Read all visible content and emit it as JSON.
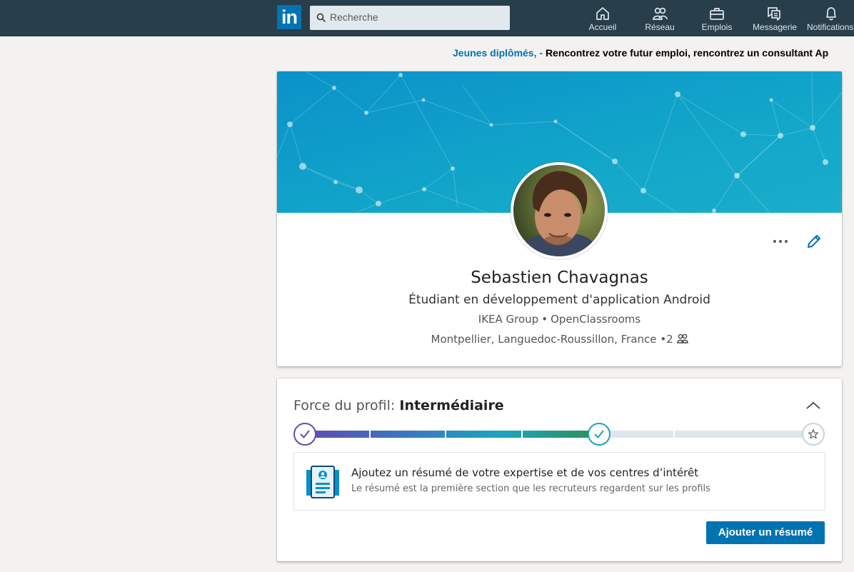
{
  "nav": {
    "search_placeholder": "Recherche",
    "items": [
      {
        "label": "Accueil",
        "icon": "home-icon"
      },
      {
        "label": "Réseau",
        "icon": "network-icon"
      },
      {
        "label": "Emplois",
        "icon": "briefcase-icon"
      },
      {
        "label": "Messagerie",
        "icon": "messaging-icon"
      },
      {
        "label": "Notifications",
        "icon": "bell-icon"
      }
    ]
  },
  "ad": {
    "link": "Jeunes diplômés, -",
    "text": "Rencontrez votre futur emploi, rencontrez un consultant Ap"
  },
  "profile": {
    "name": "Sebastien Chavagnas",
    "headline": "Étudiant en développement d'application Android",
    "company": "IKEA Group",
    "school": "OpenClassrooms",
    "location": "Montpellier, Languedoc-Roussillon, France",
    "connections": "2"
  },
  "strength": {
    "label": "Force du profil:",
    "level": "Intermédiaire",
    "progress_fraction": 0.57,
    "suggestion_title": "Ajoutez un résumé de votre expertise et de vos centres d’intérêt",
    "suggestion_sub": "Le résumé est la première section que les recruteurs regardent sur les profils",
    "button": "Ajouter un résumé"
  },
  "colors": {
    "nav_bg": "#283e4a",
    "brand": "#0073b1",
    "meter_start": "#5c4fb3",
    "meter_end": "#2e8f5a"
  }
}
